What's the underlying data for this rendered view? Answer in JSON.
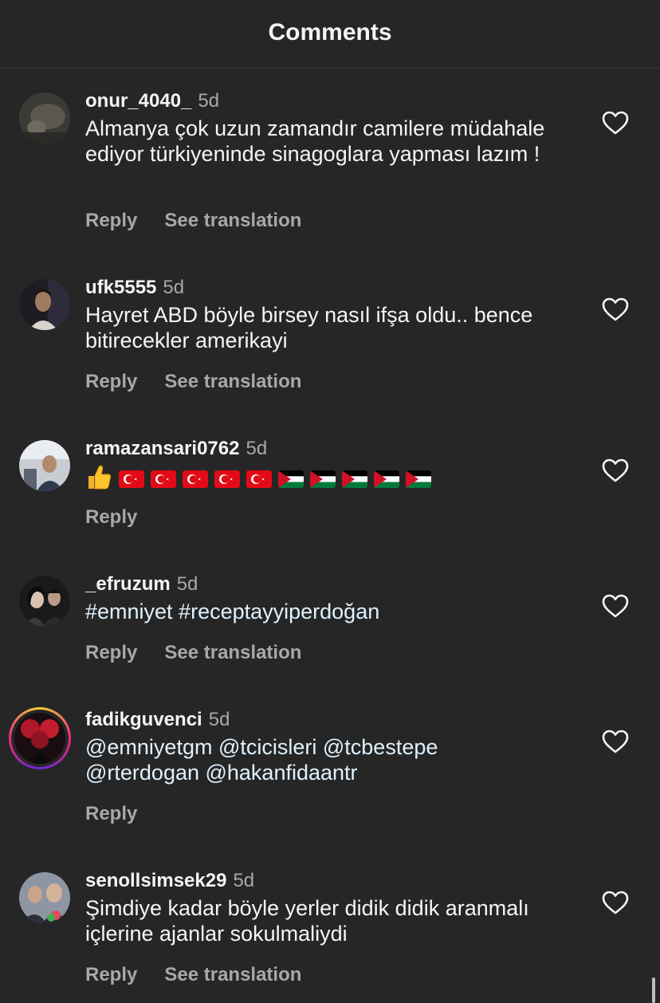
{
  "header": {
    "title": "Comments"
  },
  "comments": [
    {
      "username": "onur_4040_",
      "time": "5d",
      "text": "Almanya çok uzun zamandır camilere müdahale ediyor türkiyeninde sinagoglara yapması lazım !",
      "reply_label": "Reply",
      "translate_label": "See translation"
    },
    {
      "username": "ufk5555",
      "time": "5d",
      "text": "Hayret ABD böyle birsey nasıl ifşa oldu.. bence bitirecekler amerikayi",
      "reply_label": "Reply",
      "translate_label": "See translation"
    },
    {
      "username": "ramazansari0762",
      "time": "5d",
      "emoji": [
        "thumbs-up",
        "flag-turkey",
        "flag-turkey",
        "flag-turkey",
        "flag-turkey",
        "flag-turkey",
        "flag-jordan",
        "flag-jordan",
        "flag-jordan",
        "flag-jordan",
        "flag-jordan"
      ],
      "reply_label": "Reply"
    },
    {
      "username": "_efruzum",
      "time": "5d",
      "text": "#emniyet #receptayyiperdoğan",
      "reply_label": "Reply",
      "translate_label": "See translation"
    },
    {
      "username": "fadikguvenci",
      "time": "5d",
      "text": "@emniyetgm @tcicisleri @tcbestepe @rterdogan @hakanfidaantr",
      "reply_label": "Reply"
    },
    {
      "username": "senollsimsek29",
      "time": "5d",
      "text": "Şimdiye kadar böyle yerler didik didik aranmalı içlerine ajanlar sokulmaliydi",
      "reply_label": "Reply",
      "translate_label": "See translation"
    }
  ],
  "colors": {
    "background": "#262626",
    "text_primary": "#f5f5f5",
    "text_secondary": "#a8a8a8",
    "divider": "#3a3a3a",
    "mention": "#e0f1ff"
  }
}
